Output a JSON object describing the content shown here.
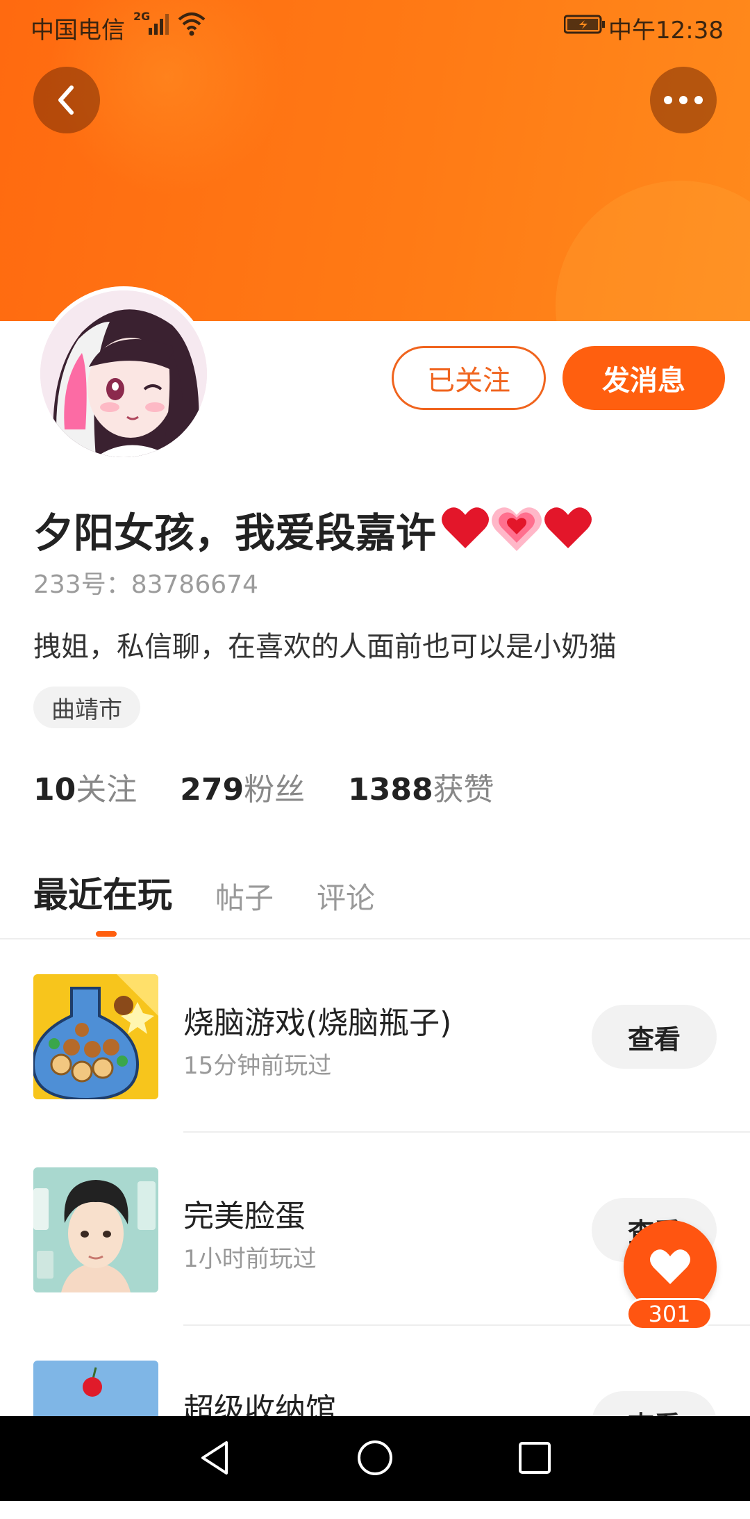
{
  "status_bar": {
    "carrier": "中国电信",
    "network": "2G",
    "time": "中午12:38"
  },
  "header": {
    "back_icon": "chevron-left-icon",
    "more_icon": "more-horizontal-icon",
    "colors": {
      "gradient_start": "#ff6a10",
      "gradient_end": "#ff8a1c"
    }
  },
  "profile": {
    "name": "夕阳女孩，我爱段嘉许",
    "name_emoji": [
      "red-heart",
      "pink-heart",
      "red-heart"
    ],
    "uid": "233号：83786674",
    "bio": "拽姐，私信聊，在喜欢的人面前也可以是小奶猫",
    "location_tag": "曲靖市",
    "follow_button": "已关注",
    "message_button": "发消息"
  },
  "stats": [
    {
      "count": "10",
      "label": "关注"
    },
    {
      "count": "279",
      "label": "粉丝"
    },
    {
      "count": "1388",
      "label": "获赞"
    }
  ],
  "tabs": [
    {
      "label": "最近在玩",
      "active": true
    },
    {
      "label": "帖子",
      "active": false
    },
    {
      "label": "评论",
      "active": false
    }
  ],
  "games": [
    {
      "title": "烧脑游戏(烧脑瓶子)",
      "subtitle": "15分钟前玩过",
      "button": "查看"
    },
    {
      "title": "完美脸蛋",
      "subtitle": "1小时前玩过",
      "button": "查看"
    },
    {
      "title": "超级收纳馆",
      "subtitle": "",
      "button": "查看"
    }
  ],
  "like_fab": {
    "icon": "heart-icon",
    "count": "301"
  },
  "nav_bar": {
    "back": "triangle-back-icon",
    "home": "circle-home-icon",
    "recents": "square-recents-icon"
  },
  "accent_color": "#ff5f0f"
}
